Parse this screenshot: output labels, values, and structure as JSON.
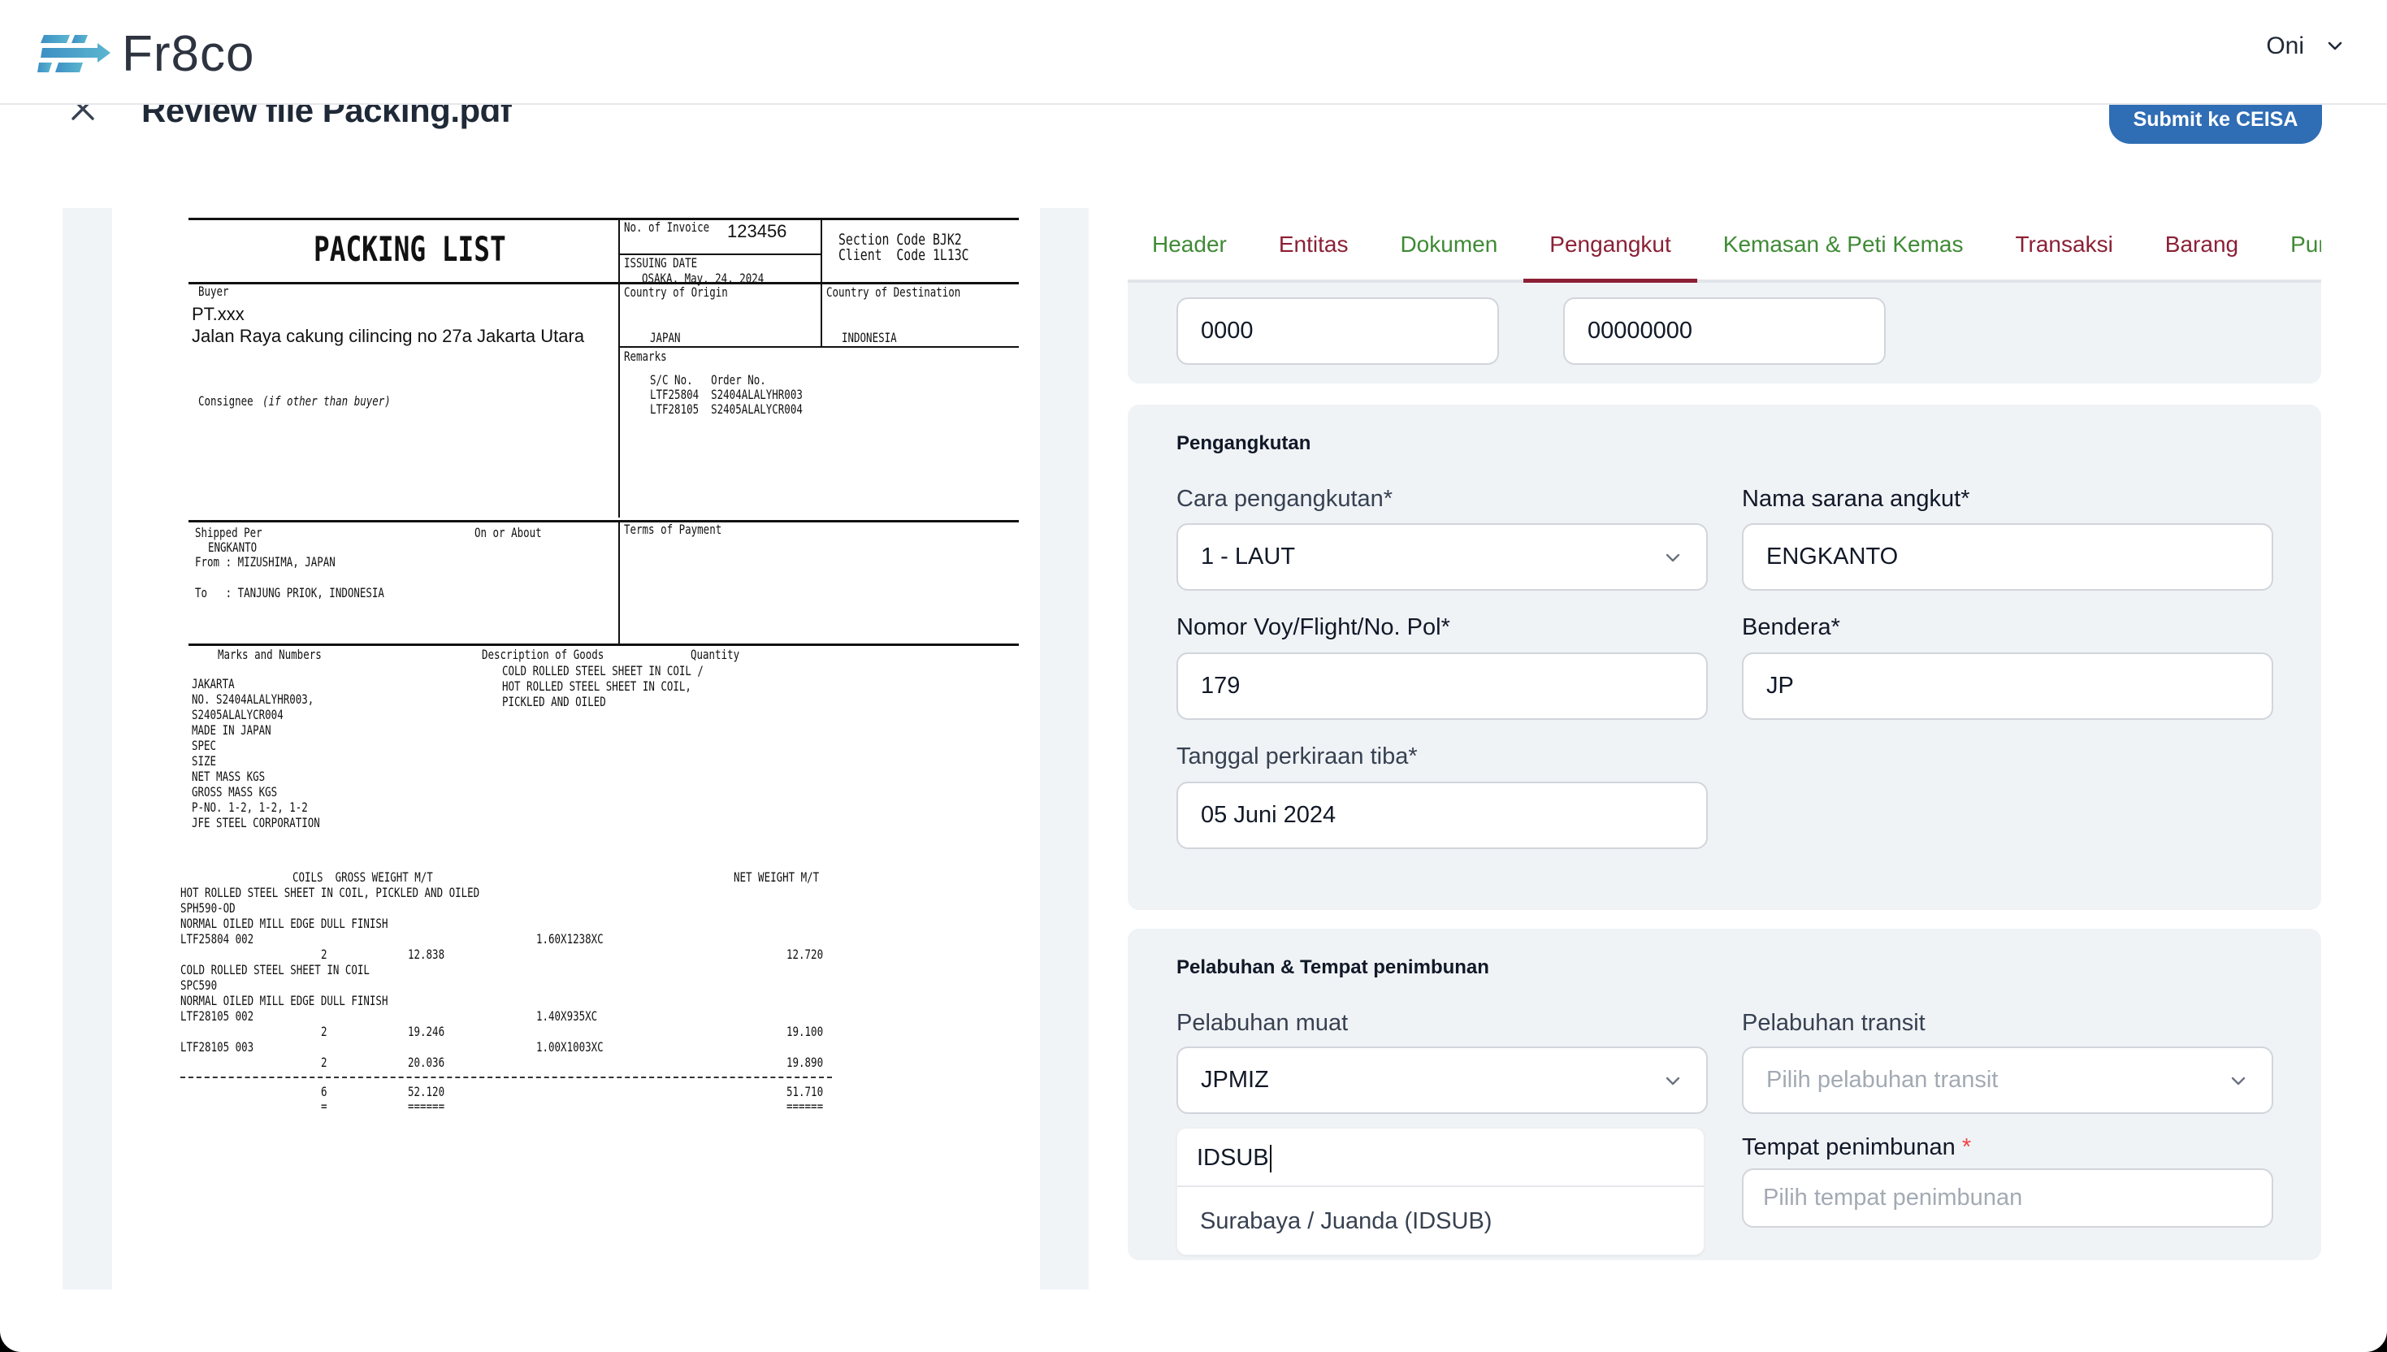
{
  "app": {
    "brand": "Fr8co",
    "user_name": "Oni"
  },
  "page": {
    "title": "Review file Packing.pdf",
    "submit_label": "Submit ke CEISA"
  },
  "document": {
    "title": "PACKING LIST",
    "invoice_label": "No. of Invoice",
    "invoice_no": "123456",
    "issuing_date_label": "ISSUING DATE",
    "issuing_date": "OSAKA, May. 24, 2024",
    "section_code": "Section Code BJK2",
    "client_code": "Client  Code 1L13C",
    "buyer_label": "Buyer",
    "buyer_name": "PT.xxx",
    "buyer_address": "Jalan Raya cakung cilincing no 27a Jakarta Utara",
    "origin_label": "Country of Origin",
    "origin": "JAPAN",
    "destination_label": "Country of Destination",
    "destination": "INDONESIA",
    "remarks_label": "Remarks",
    "remarks_header": "S/C No.   Order No.",
    "remarks_lines": [
      "LTF25804  S2404ALALYHR003",
      "LTF28105  S2405ALALYCR004"
    ],
    "consignee_label": "Consignee",
    "consignee_note": "(if other than buyer)",
    "shipped_per_label": "Shipped Per",
    "vessel": "ENGKANTO",
    "on_or_about_label": "On or About",
    "from_line": "From : MIZUSHIMA, JAPAN",
    "to_line": "To   : TANJUNG PRIOK, INDONESIA",
    "terms_label": "Terms of Payment",
    "marks_label": "Marks and Numbers",
    "description_label": "Description of Goods",
    "quantity_label": "Quantity",
    "marks_lines": [
      "JAKARTA",
      "NO. S2404ALALYHR003,",
      "S2405ALALYCR004",
      "MADE IN JAPAN",
      "SPEC",
      "SIZE",
      "NET MASS KGS",
      "GROSS MASS KGS",
      "P-NO. 1-2, 1-2, 1-2",
      "JFE STEEL CORPORATION"
    ],
    "description_lines": [
      "COLD ROLLED STEEL SHEET IN COIL /",
      "HOT ROLLED STEEL SHEET IN COIL,",
      "PICKLED AND OILED"
    ],
    "table_header_left": "COILS  GROSS WEIGHT M/T",
    "table_header_right": "NET WEIGHT M/T",
    "goods": [
      {
        "line": "HOT ROLLED STEEL SHEET IN COIL, PICKLED AND OILED"
      },
      {
        "line": "SPH590-OD"
      },
      {
        "line": "NORMAL OILED MILL EDGE DULL FINISH"
      },
      {
        "lot": "LTF25804 002",
        "size": "1.60X1238XC",
        "coils": "2",
        "gross": "12.838",
        "net": "12.720"
      },
      {
        "line": "COLD ROLLED STEEL SHEET IN COIL"
      },
      {
        "line": "SPC590"
      },
      {
        "line": "NORMAL OILED MILL EDGE DULL FINISH"
      },
      {
        "lot": "LTF28105 002",
        "size": "1.40X935XC",
        "coils": "2",
        "gross": "19.246",
        "net": "19.100"
      },
      {
        "lot": "LTF28105 003",
        "size": "1.00X1003XC",
        "coils": "2",
        "gross": "20.036",
        "net": "19.890"
      }
    ],
    "total_coils": "6",
    "total_gross": "52.120",
    "total_net": "51.710",
    "total_underline_coils": "=",
    "total_underline": "======"
  },
  "tabs": [
    {
      "label": "Header",
      "state": "green"
    },
    {
      "label": "Entitas",
      "state": "maroon"
    },
    {
      "label": "Dokumen",
      "state": "green"
    },
    {
      "label": "Pengangkut",
      "state": "maroon",
      "active": true
    },
    {
      "label": "Kemasan & Peti Kemas",
      "state": "green"
    },
    {
      "label": "Transaksi",
      "state": "maroon"
    },
    {
      "label": "Barang",
      "state": "maroon"
    },
    {
      "label": "Pungutan",
      "state": "green"
    }
  ],
  "top_fields": {
    "field1_value": "0000",
    "field2_value": "00000000"
  },
  "pengangkutan": {
    "title": "Pengangkutan",
    "cara_label": "Cara pengangkutan*",
    "cara_value": "1 - LAUT",
    "nama_label": "Nama sarana angkut*",
    "nama_value": "ENGKANTO",
    "voy_label": "Nomor Voy/Flight/No. Pol*",
    "voy_value": "179",
    "bendera_label": "Bendera*",
    "bendera_value": "JP",
    "tanggal_label": "Tanggal perkiraan tiba*",
    "tanggal_value": "05 Juni 2024"
  },
  "pelabuhan": {
    "title": "Pelabuhan & Tempat penimbunan",
    "muat_label": "Pelabuhan muat",
    "muat_value": "JPMIZ",
    "transit_label": "Pelabuhan transit",
    "transit_placeholder": "Pilih pelabuhan transit",
    "search_value": "IDSUB",
    "search_option": "Surabaya / Juanda (IDSUB)",
    "tempat_label": "Tempat penimbunan",
    "tempat_required_mark": "*",
    "tempat_placeholder": "Pilih tempat penimbunan"
  },
  "colors": {
    "primary": "#2f6db5",
    "tab_green": "#3f8a35",
    "tab_maroon": "#8b2035",
    "card_bg": "#f0f3f6"
  }
}
